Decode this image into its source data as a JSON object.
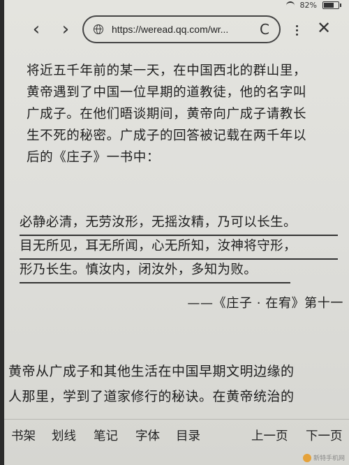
{
  "status_bar": {
    "battery": "82%"
  },
  "browser": {
    "url": "https://weread.qq.com/wr...",
    "back_label": "‹",
    "forward_label": "›",
    "reload_label": "C",
    "close_label": "✕"
  },
  "reader": {
    "intro_lines": [
      "将近五千年前的某一天，在中国西北的群山里，",
      "黄帝遇到了中国一位早期的道教徒，他的名字叫",
      "广成子。在他们晤谈期间，黄帝向广成子请教长",
      "生不死的秘密。广成子的回答被记载在两千年以",
      "后的《庄子》一书中："
    ],
    "quote_lines": [
      "必静必清，无劳汝形，无摇汝精，乃可以长生。",
      "目无所见，耳无所闻，心无所知，汝神将守形，",
      "形乃长生。慎汝内，闭汝外，多知为败。"
    ],
    "quote_source": "——《庄子 · 在宥》第十一",
    "next_lines": [
      "黄帝从广成子和其他生活在中国早期文明边缘的",
      "人那里，学到了道家修行的秘诀。在黄帝统治的"
    ]
  },
  "toolbar": {
    "bookshelf": "书架",
    "highlight": "划线",
    "notes": "笔记",
    "font": "字体",
    "contents": "目录",
    "prev_page": "上一页",
    "next_page": "下一页"
  },
  "watermark": "新特手机网"
}
